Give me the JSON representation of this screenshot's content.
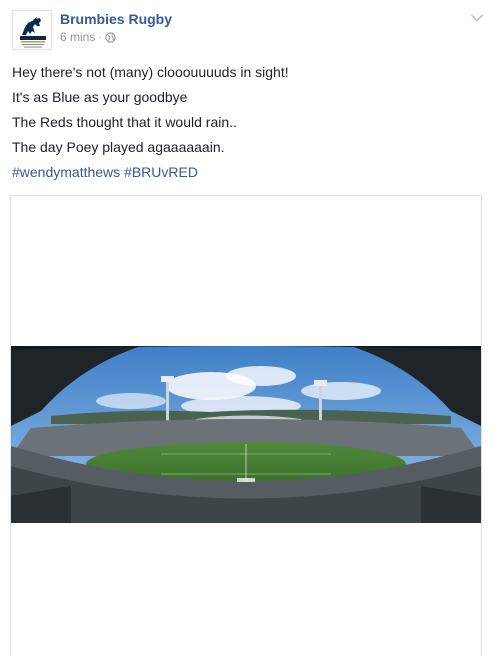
{
  "post": {
    "page_name": "Brumbies Rugby",
    "timestamp": "6 mins",
    "separator": "·",
    "audience_icon": "globe-icon",
    "options_icon": "chevron-down-icon",
    "lines": [
      "Hey there's not (many) clooouuuuds in sight!",
      "It's as Blue as your goodbye",
      "The Reds thought that it would rain..",
      "The day Poey played agaaaaaain."
    ],
    "hashtags": [
      "#wendymatthews",
      "#BRUvRED"
    ],
    "photo": "stadium-panorama-image"
  },
  "colors": {
    "link": "#365899",
    "text": "#1d2129",
    "meta": "#90949c",
    "border": "#dddfe2"
  }
}
